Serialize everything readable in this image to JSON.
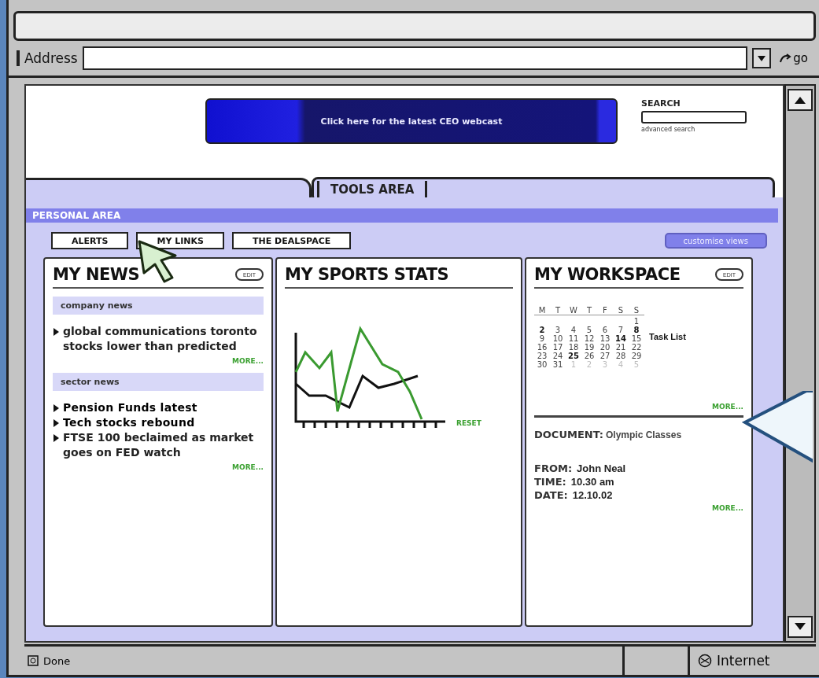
{
  "address_bar": {
    "label": "Address",
    "go": "go"
  },
  "banner": {
    "text": "Click here for the latest CEO webcast"
  },
  "search": {
    "label": "SEARCH",
    "link": "advanced search"
  },
  "tools_tab": {
    "label": "TOOLS AREA"
  },
  "personal_area": {
    "title": "PERSONAL AREA",
    "tabs": [
      {
        "label": "ALERTS",
        "selected": false
      },
      {
        "label": "MY LINKS",
        "selected": false
      },
      {
        "label": "THE DEALSPACE",
        "selected": false
      }
    ],
    "customise": "customise views"
  },
  "my_news": {
    "title": "MY NEWS",
    "edit": "EDIT",
    "sections": [
      {
        "heading": "company news",
        "items": [
          {
            "text": "global communications toronto stocks lower than predicted",
            "bold": false
          }
        ],
        "more": "MORE..."
      },
      {
        "heading": "sector news",
        "items": [
          {
            "text": "Pension Funds latest",
            "bold": true
          },
          {
            "text": "Tech stocks rebound",
            "bold": true
          },
          {
            "text": "FTSE 100 beclaimed as market goes on FED watch",
            "bold": false
          }
        ],
        "more": "MORE..."
      }
    ]
  },
  "sports_stats": {
    "title": "MY SPORTS STATS",
    "reset": "RESET"
  },
  "my_workspace": {
    "title": "MY WORKSPACE",
    "edit": "EDIT",
    "calendar": {
      "weekdays": [
        "M",
        "T",
        "W",
        "T",
        "F",
        "S",
        "S"
      ],
      "weeks": [
        [
          {
            "d": "1",
            "bold": false,
            "other_month": false
          }
        ],
        [
          {
            "d": "2",
            "bold": true,
            "other_month": false
          },
          {
            "d": "3",
            "bold": false,
            "other_month": false
          },
          {
            "d": "4",
            "bold": false,
            "other_month": false
          },
          {
            "d": "5",
            "bold": false,
            "other_month": false
          },
          {
            "d": "6",
            "bold": false,
            "other_month": false
          },
          {
            "d": "7",
            "bold": false,
            "other_month": false
          },
          {
            "d": "8",
            "bold": true,
            "other_month": false
          }
        ],
        [
          {
            "d": "9",
            "bold": false,
            "other_month": false
          },
          {
            "d": "10",
            "bold": false,
            "other_month": false
          },
          {
            "d": "11",
            "bold": false,
            "other_month": false
          },
          {
            "d": "12",
            "bold": false,
            "other_month": false
          },
          {
            "d": "13",
            "bold": false,
            "other_month": false
          },
          {
            "d": "14",
            "bold": true,
            "other_month": false
          },
          {
            "d": "15",
            "bold": false,
            "other_month": false
          }
        ],
        [
          {
            "d": "16",
            "bold": false,
            "other_month": false
          },
          {
            "d": "17",
            "bold": false,
            "other_month": false
          },
          {
            "d": "18",
            "bold": false,
            "other_month": false
          },
          {
            "d": "19",
            "bold": false,
            "other_month": false
          },
          {
            "d": "20",
            "bold": false,
            "other_month": false
          },
          {
            "d": "21",
            "bold": false,
            "other_month": false
          },
          {
            "d": "22",
            "bold": false,
            "other_month": false
          }
        ],
        [
          {
            "d": "23",
            "bold": false,
            "other_month": false
          },
          {
            "d": "24",
            "bold": false,
            "other_month": false
          },
          {
            "d": "25",
            "bold": true,
            "other_month": false
          },
          {
            "d": "26",
            "bold": false,
            "other_month": false
          },
          {
            "d": "27",
            "bold": false,
            "other_month": false
          },
          {
            "d": "28",
            "bold": false,
            "other_month": false
          },
          {
            "d": "29",
            "bold": false,
            "other_month": false
          }
        ],
        [
          {
            "d": "30",
            "bold": false,
            "other_month": false
          },
          {
            "d": "31",
            "bold": false,
            "other_month": false
          },
          {
            "d": "1",
            "bold": false,
            "other_month": true
          },
          {
            "d": "2",
            "bold": false,
            "other_month": true
          },
          {
            "d": "3",
            "bold": false,
            "other_month": true
          },
          {
            "d": "4",
            "bold": false,
            "other_month": true
          },
          {
            "d": "5",
            "bold": false,
            "other_month": true
          }
        ]
      ]
    },
    "task_list": "Task List",
    "calendar_more": "MORE...",
    "document": {
      "label": "DOCUMENT:",
      "value": "Olympic Classes"
    },
    "fields": [
      {
        "label": "FROM:",
        "value": "John Neal"
      },
      {
        "label": "TIME:",
        "value": "10.30 am"
      },
      {
        "label": "DATE:",
        "value": "12.10.02"
      }
    ],
    "more": "MORE..."
  },
  "status_bar": {
    "text": "Done",
    "zone": "Internet"
  }
}
